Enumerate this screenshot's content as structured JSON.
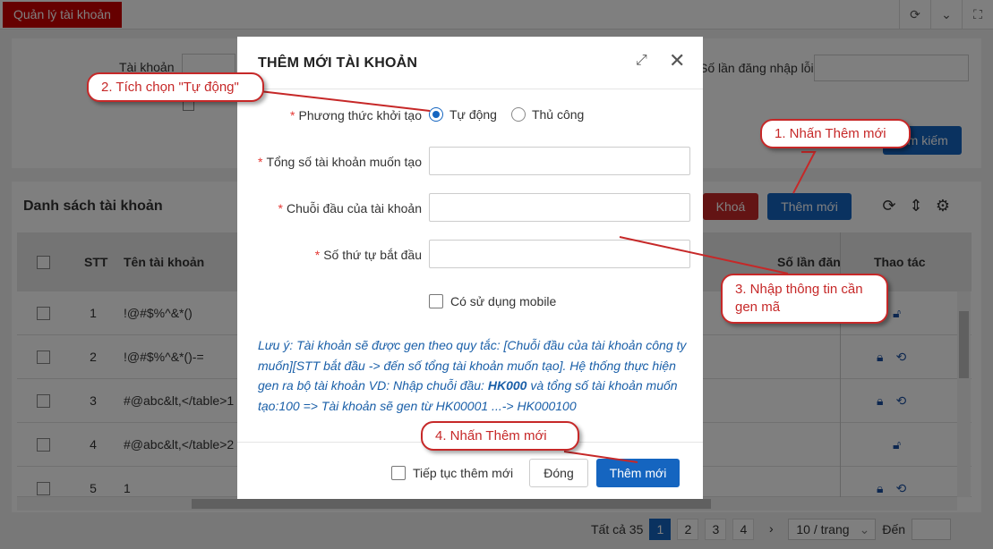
{
  "topbar": {
    "tab_label": "Quản lý tài khoản"
  },
  "filter": {
    "account_label": "Tài khoản",
    "login_fail_label": "Số lần đăng nhập lỗi",
    "search_button": "Tìm kiếm"
  },
  "list": {
    "title": "Danh sách tài khoản",
    "lock_button": "Khoá",
    "add_button": "Thêm mới",
    "columns": {
      "stt": "STT",
      "name": "Tên tài khoản",
      "login_count": "Số lần đăn",
      "actions": "Thao tác"
    },
    "rows": [
      {
        "stt": "1",
        "name": "!@#$%^&*()"
      },
      {
        "stt": "2",
        "name": "!@#$%^&*()-="
      },
      {
        "stt": "3",
        "name": "#@abc&lt,</table>1"
      },
      {
        "stt": "4",
        "name": "#@abc&lt,</table>2"
      },
      {
        "stt": "5",
        "name": "1"
      }
    ]
  },
  "pagination": {
    "total": "Tất cả 35",
    "pages": [
      "1",
      "2",
      "3",
      "4"
    ],
    "page_size": "10 / trang",
    "goto_label": "Đến"
  },
  "modal": {
    "title": "THÊM MỚI TÀI KHOẢN",
    "method_label": "Phương thức khởi tạo",
    "method_auto": "Tự động",
    "method_manual": "Thủ công",
    "total_label": "Tổng số tài khoản muốn tạo",
    "prefix_label": "Chuỗi đầu của tài khoản",
    "start_label": "Số thứ tự bắt đầu",
    "mobile_label": "Có sử dụng mobile",
    "note_part1": "Lưu ý: Tài khoản sẽ được gen theo quy tắc: [Chuỗi đầu của tài khoản công ty muốn][STT bắt đầu -> đến số tổng tài khoản muốn tạo]. Hệ thống thực hiện gen ra bộ tài khoản VD: Nhập chuỗi đầu: ",
    "note_bold": "HK000",
    "note_part2": " và tổng số tài khoản muốn tạo:100 => Tài khoản sẽ gen từ HK00001 ...-> HK000100",
    "continue_label": "Tiếp tục thêm mới",
    "close_button": "Đóng",
    "submit_button": "Thêm mới"
  },
  "callouts": {
    "step1": "1. Nhấn Thêm mới",
    "step2": "2. Tích chọn \"Tự động\"",
    "step3": "3. Nhập thông tin cần gen mã",
    "step4": "4. Nhấn Thêm mới"
  },
  "colors": {
    "primary": "#1565c0",
    "danger": "#c62828",
    "note": "#1a5fa8"
  }
}
